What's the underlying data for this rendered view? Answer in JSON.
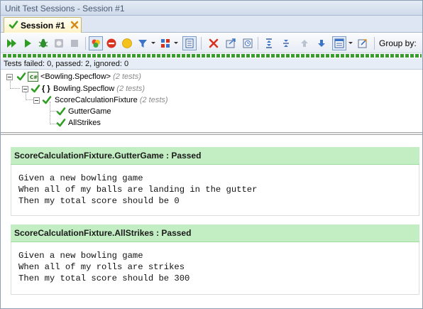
{
  "window": {
    "title": "Unit Test Sessions - Session #1"
  },
  "tab": {
    "label": "Session #1"
  },
  "toolbar": {
    "buttons": [
      {
        "name": "run-all-icon"
      },
      {
        "name": "run-icon"
      },
      {
        "name": "debug-icon"
      },
      {
        "name": "profile-icon"
      },
      {
        "name": "stop-icon"
      },
      {
        "name": "show-all-icon"
      },
      {
        "name": "failed-filter-icon"
      },
      {
        "name": "ignored-filter-icon"
      },
      {
        "name": "filter-icon"
      },
      {
        "name": "categories-icon"
      },
      {
        "name": "show-output-icon"
      },
      {
        "name": "remove-icon"
      },
      {
        "name": "export-icon"
      },
      {
        "name": "timestamp-icon"
      },
      {
        "name": "expand-all-icon"
      },
      {
        "name": "collapse-all-icon"
      },
      {
        "name": "move-up-icon"
      },
      {
        "name": "move-down-icon"
      },
      {
        "name": "layout-icon"
      },
      {
        "name": "options-icon"
      }
    ],
    "group_by_label": "Group by:"
  },
  "status": {
    "text": "Tests failed: 0, passed: 2, ignored: 0"
  },
  "tree": {
    "project": {
      "label": "<Bowling.Specflow>",
      "count": "(2 tests)"
    },
    "namespace": {
      "label": "Bowling.Specflow",
      "count": "(2 tests)"
    },
    "fixture": {
      "label": "ScoreCalculationFixture",
      "count": "(2 tests)"
    },
    "tests": [
      {
        "label": "GutterGame"
      },
      {
        "label": "AllStrikes"
      }
    ]
  },
  "results": [
    {
      "header": "ScoreCalculationFixture.GutterGame : Passed",
      "lines": [
        "Given a new bowling game",
        "When all of my balls are landing in the gutter",
        "Then my total score should be 0"
      ]
    },
    {
      "header": "ScoreCalculationFixture.AllStrikes : Passed",
      "lines": [
        "Given a new bowling game",
        "When all of my rolls are strikes",
        "Then my total score should be 300"
      ]
    }
  ],
  "colors": {
    "passed_check": "#3aa52b",
    "result_header_bg": "#c3eec3",
    "progress_green": "#3a9c2e",
    "tab_bg": "#fdf3c8"
  }
}
